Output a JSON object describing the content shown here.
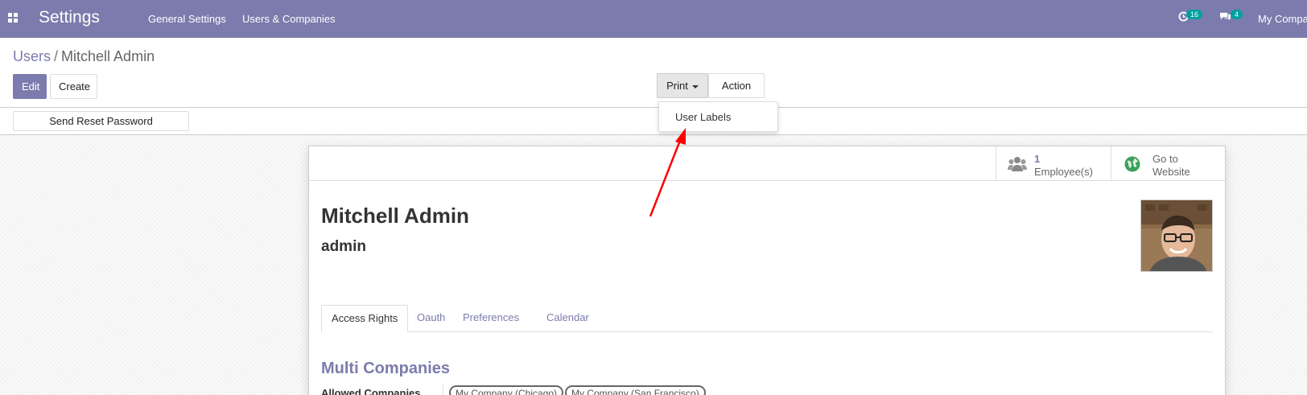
{
  "navbar": {
    "app_title": "Settings",
    "menu": [
      "General Settings",
      "Users & Companies"
    ],
    "activity_count": "16",
    "messages_count": "4",
    "company": "My Company"
  },
  "breadcrumb": {
    "parent": "Users",
    "separator": "/",
    "current": "Mitchell Admin"
  },
  "buttons": {
    "edit": "Edit",
    "create": "Create",
    "print": "Print",
    "action": "Action",
    "reset_password": "Send Reset Password Instructions"
  },
  "print_menu": {
    "items": [
      "User Labels"
    ]
  },
  "stat_buttons": {
    "employees_count": "1",
    "employees_label": "Employee(s)",
    "website_line1": "Go to",
    "website_line2": "Website"
  },
  "user": {
    "name": "Mitchell Admin",
    "login": "admin"
  },
  "tabs": [
    "Access Rights",
    "Oauth",
    "Preferences",
    "Calendar"
  ],
  "access_rights": {
    "section_title": "Multi Companies",
    "allowed_companies_label": "Allowed Companies",
    "allowed_companies": [
      "My Company (Chicago)",
      "My Company (San Francisco)"
    ]
  },
  "colors": {
    "brand": "#7c7bad",
    "badge": "#00a09d",
    "annotation_arrow": "#ff0000"
  }
}
